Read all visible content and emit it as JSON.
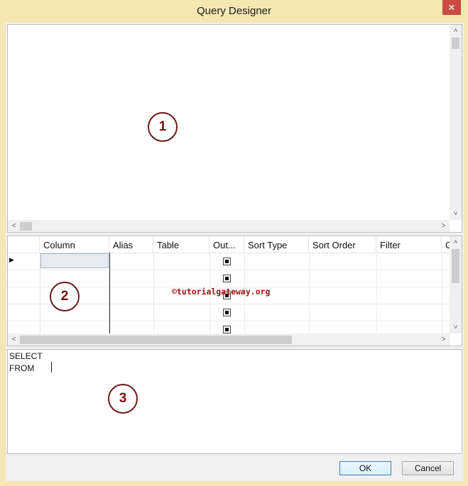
{
  "window": {
    "title": "Query Designer",
    "close_glyph": "✕"
  },
  "diagram_pane": {
    "marker": "1"
  },
  "grid_pane": {
    "marker": "2",
    "columns": [
      "Column",
      "Alias",
      "Table",
      "Out...",
      "Sort Type",
      "Sort Order",
      "Filter",
      "O"
    ],
    "row_indicator": "▶",
    "watermark": "©tutorialgateway.org"
  },
  "sql_pane": {
    "marker": "3",
    "lines": [
      "SELECT",
      "FROM"
    ]
  },
  "buttons": {
    "ok": "OK",
    "cancel": "Cancel"
  },
  "scroll": {
    "up": "˄",
    "down": "˅",
    "left": "<",
    "right": ">"
  }
}
